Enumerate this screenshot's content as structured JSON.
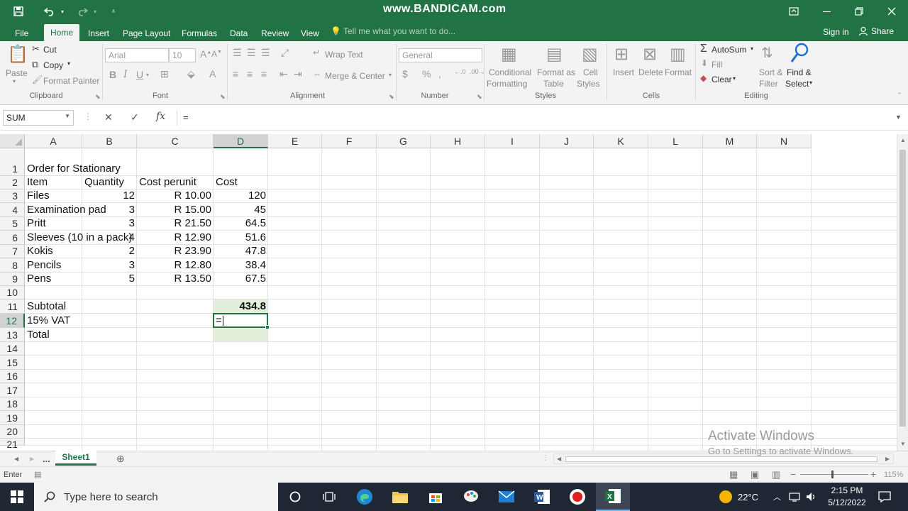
{
  "watermark": "www.BANDICAM.com",
  "tabs": [
    "File",
    "Home",
    "Insert",
    "Page Layout",
    "Formulas",
    "Data",
    "Review",
    "View"
  ],
  "tell_me": "Tell me what you want to do...",
  "sign_in": "Sign in",
  "share": "Share",
  "ribbon": {
    "clipboard": {
      "paste": "Paste",
      "cut": "Cut",
      "copy": "Copy",
      "format_painter": "Format Painter",
      "label": "Clipboard"
    },
    "font": {
      "name": "Arial",
      "size": "10",
      "label": "Font"
    },
    "alignment": {
      "wrap": "Wrap Text",
      "merge": "Merge & Center",
      "label": "Alignment"
    },
    "number": {
      "format": "General",
      "label": "Number"
    },
    "styles": {
      "conditional": "Conditional",
      "formatting": "Formatting",
      "format_as": "Format as",
      "table": "Table",
      "cell": "Cell",
      "styles": "Styles",
      "label": "Styles"
    },
    "cells": {
      "insert": "Insert",
      "delete": "Delete",
      "format": "Format",
      "label": "Cells"
    },
    "editing": {
      "autosum": "AutoSum",
      "fill": "Fill",
      "clear": "Clear",
      "sort": "Sort &",
      "filter": "Filter",
      "find": "Find &",
      "select": "Select",
      "label": "Editing"
    }
  },
  "formula_bar": {
    "name_box": "SUM",
    "content": "="
  },
  "columns": [
    "A",
    "B",
    "C",
    "D",
    "E",
    "F",
    "G",
    "H",
    "I",
    "J",
    "K",
    "L",
    "M",
    "N"
  ],
  "rows": [
    "1",
    "2",
    "3",
    "4",
    "5",
    "6",
    "7",
    "8",
    "9",
    "10",
    "11",
    "12",
    "13",
    "14",
    "15",
    "16",
    "17",
    "18",
    "19",
    "20",
    "21"
  ],
  "cells": {
    "A1": "Order for Stationary",
    "A2": "Item",
    "B2": "Quantity",
    "C2": "Cost perunit",
    "D2": "Cost",
    "A3": "Files",
    "B3": "12",
    "C3": "R 10.00",
    "D3": "120",
    "A4": "Examination pad",
    "B4": "3",
    "C4": "R 15.00",
    "D4": "45",
    "A5": "Pritt",
    "B5": "3",
    "C5": "R 21.50",
    "D5": "64.5",
    "A6": "Sleeves (10 in a pack)",
    "B6": "4",
    "C6": "R 12.90",
    "D6": "51.6",
    "A7": "Kokis",
    "B7": "2",
    "C7": "R 23.90",
    "D7": "47.8",
    "A8": "Pencils",
    "B8": "3",
    "C8": "R 12.80",
    "D8": "38.4",
    "A9": "Pens",
    "B9": "5",
    "C9": "R 13.50",
    "D9": "67.5",
    "A11": "Subtotal",
    "D11": "434.8",
    "A12": "15% VAT",
    "D12": "=",
    "A13": "Total"
  },
  "sheet_tab": "Sheet1",
  "sheet_more": "...",
  "status": {
    "mode": "Enter",
    "zoom": "115%"
  },
  "activate": {
    "line1": "Activate Windows",
    "line2": "Go to Settings to activate Windows."
  },
  "taskbar": {
    "search_placeholder": "Type here to search",
    "temperature": "22°C",
    "time": "2:15 PM",
    "date": "5/12/2022"
  }
}
